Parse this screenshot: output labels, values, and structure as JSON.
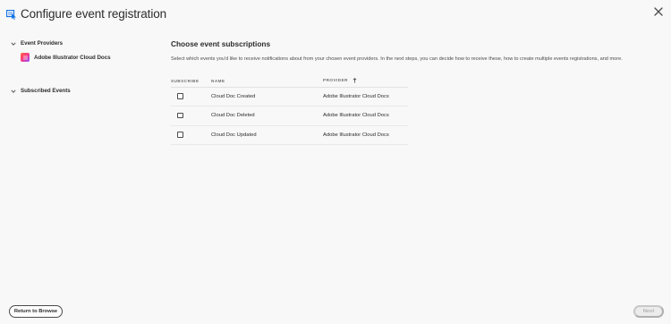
{
  "header": {
    "title": "Configure event registration",
    "icon": "event-registration-icon",
    "close_icon": "close-icon"
  },
  "sidebar": {
    "event_providers_label": "Event Providers",
    "providers": [
      {
        "label": "Adobe Illustrator Cloud Docs",
        "icon": "illustrator-cloud-docs-icon"
      }
    ],
    "subscribed_events_label": "Subscribed Events"
  },
  "main": {
    "heading": "Choose event subscriptions",
    "description": "Select which events you'd like to receive notifications about from your chosen event providers. In the next steps, you can decide how to receive these, how to create multiple events registrations, and more.",
    "table": {
      "columns": [
        "SUBSCRIBE",
        "NAME",
        "PROVIDER"
      ],
      "sort_icon": "sort-ascending-icon",
      "rows": [
        {
          "subscribed": false,
          "name": "Cloud Doc Created",
          "provider": "Adobe Illustrator Cloud Docs"
        },
        {
          "subscribed": false,
          "name": "Cloud Doc Deleted",
          "provider": "Adobe Illustrator Cloud Docs"
        },
        {
          "subscribed": false,
          "name": "Cloud Doc Updated",
          "provider": "Adobe Illustrator Cloud Docs"
        }
      ]
    }
  },
  "footer": {
    "return_label": "Return to Browse",
    "next_label": "Next"
  },
  "colors": {
    "background": "#f8f8f8",
    "text": "#2c2c2c",
    "accent_blue": "#1473e6"
  }
}
